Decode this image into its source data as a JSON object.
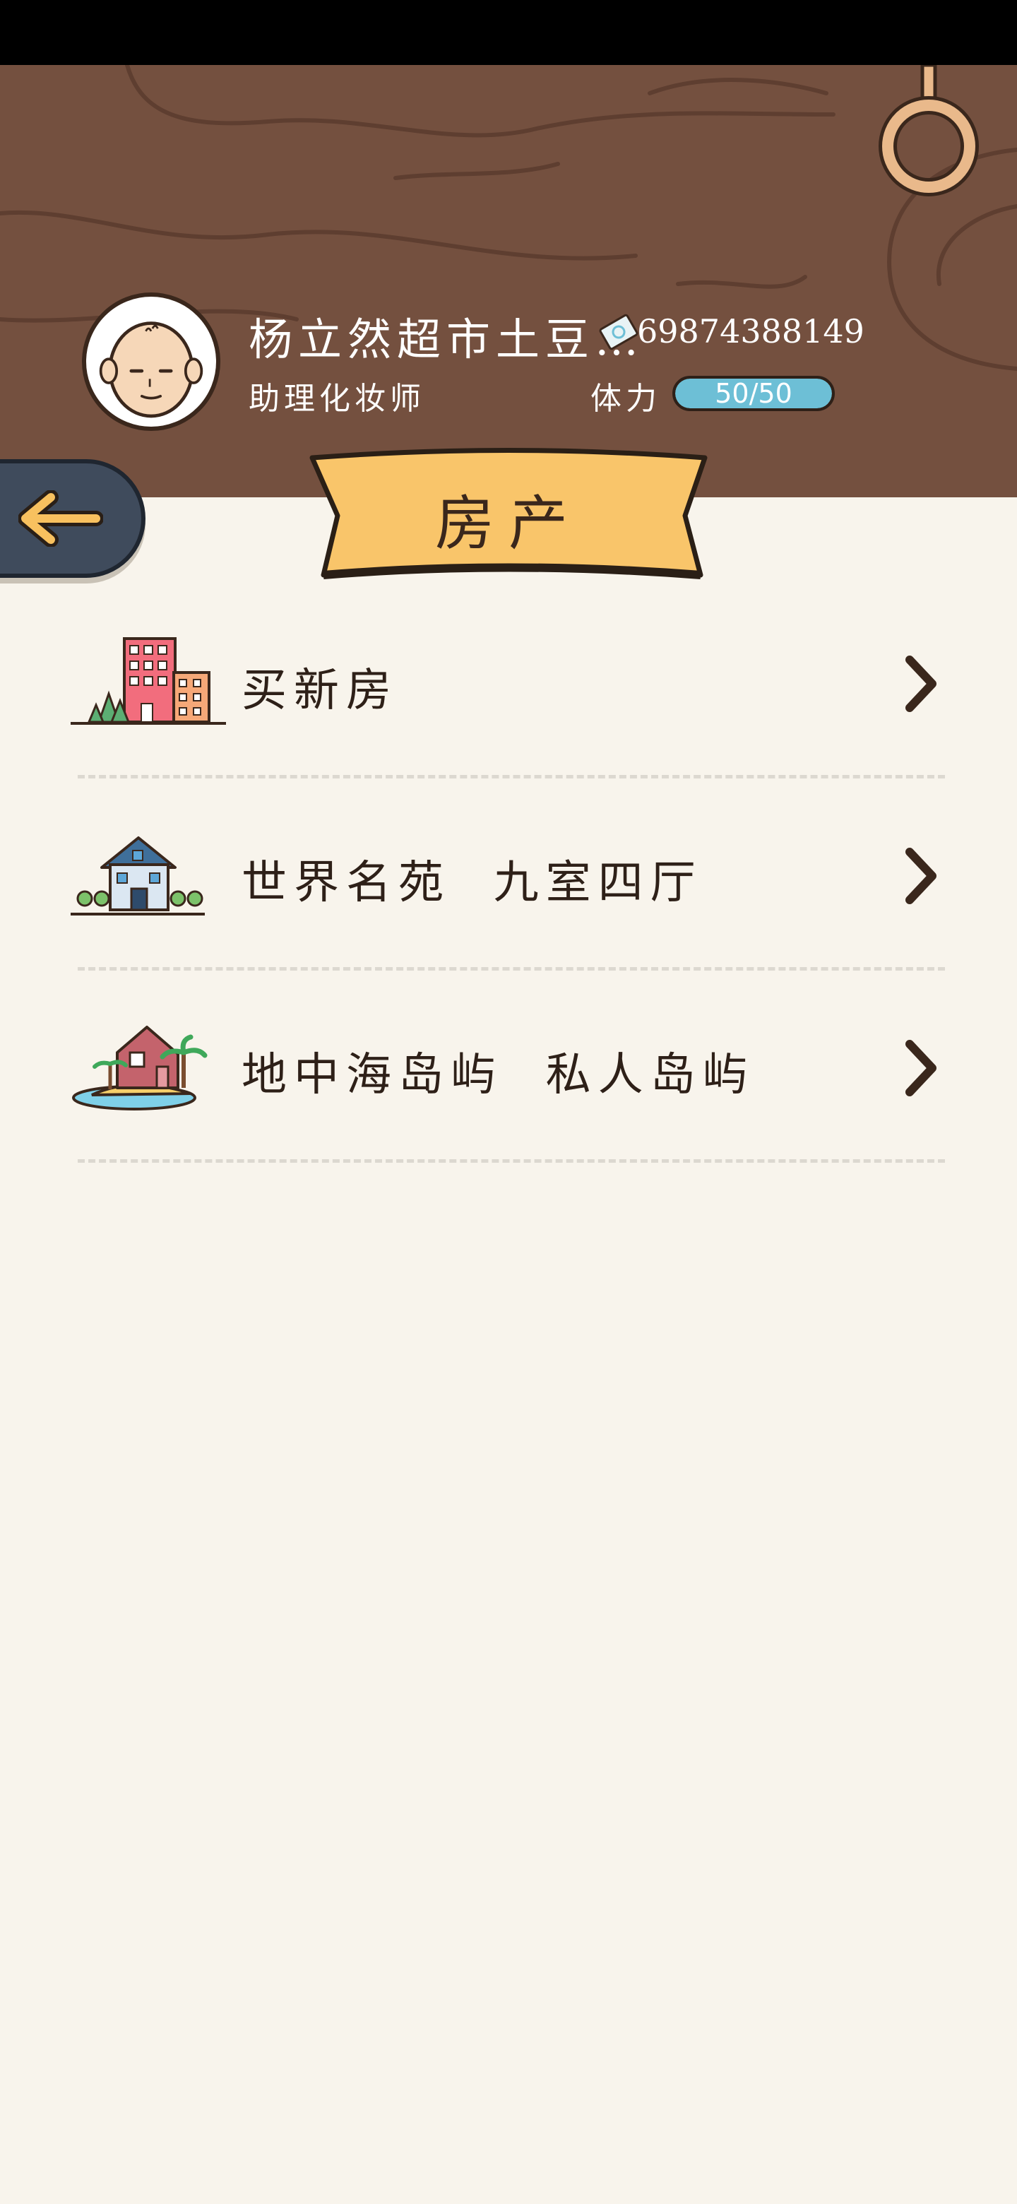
{
  "header": {
    "player_name": "杨立然超市土豆…",
    "money": "69874388149",
    "job_title": "助理化妆师",
    "stamina_label": "体力",
    "stamina_value": "50/50",
    "stamina_fraction": 1.0
  },
  "back_button": {
    "icon": "back-arrow-icon"
  },
  "title": "房产",
  "items": [
    {
      "label": "买新房",
      "icon": "apartment-building-icon"
    },
    {
      "label": "世界名苑  九室四厅",
      "icon": "villa-house-icon"
    },
    {
      "label": "地中海岛屿  私人岛屿",
      "icon": "island-house-icon"
    }
  ],
  "colors": {
    "wood": "#74503f",
    "banner": "#f9c56a",
    "stamina": "#6dbfd6",
    "background": "#f8f4ec",
    "text_dark": "#2e2018"
  }
}
